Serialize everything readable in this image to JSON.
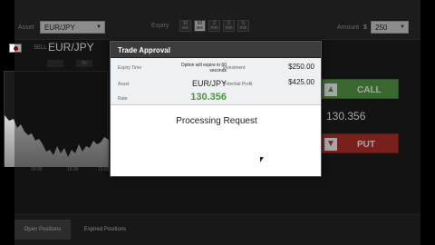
{
  "topbar": {
    "asset_label": "Asset",
    "asset_value": "EUR/JPY",
    "expiry_label": "Expiry",
    "expiry_options": [
      "30 sec",
      "60 sec",
      "2 min",
      "3 min",
      "5 min"
    ],
    "amount_label": "Amount",
    "amount_currency": "$",
    "amount_value": "250"
  },
  "asset_panel": {
    "sell_label": "SELL",
    "pair": "EUR/JPY",
    "tab_left": "",
    "tab_right": "6h",
    "chart_ticks": [
      "18:00",
      "18:30",
      "19:00"
    ]
  },
  "trade_panel": {
    "call_label": "CALL",
    "put_label": "PUT",
    "price": "130.356"
  },
  "bottom_tabs": {
    "open_positions": "Open Positions",
    "expired_positions": "Expired Positions"
  },
  "modal": {
    "title": "Trade Approval",
    "expiry_time_label": "Expiry Time",
    "expiry_time_value": "Option will expire in 60 seconds",
    "asset_label": "Asset",
    "asset_value": "EUR/JPY",
    "rate_label": "Rate",
    "rate_value": "130.356",
    "investment_label": "Investment",
    "investment_value": "$250.00",
    "potential_profit_label": "Potential Profit",
    "potential_profit_value": "$425.00",
    "status_text": "Processing Request"
  },
  "colors": {
    "call": "#5aa04a",
    "put": "#b8322c",
    "rate": "#4a9a3a"
  }
}
